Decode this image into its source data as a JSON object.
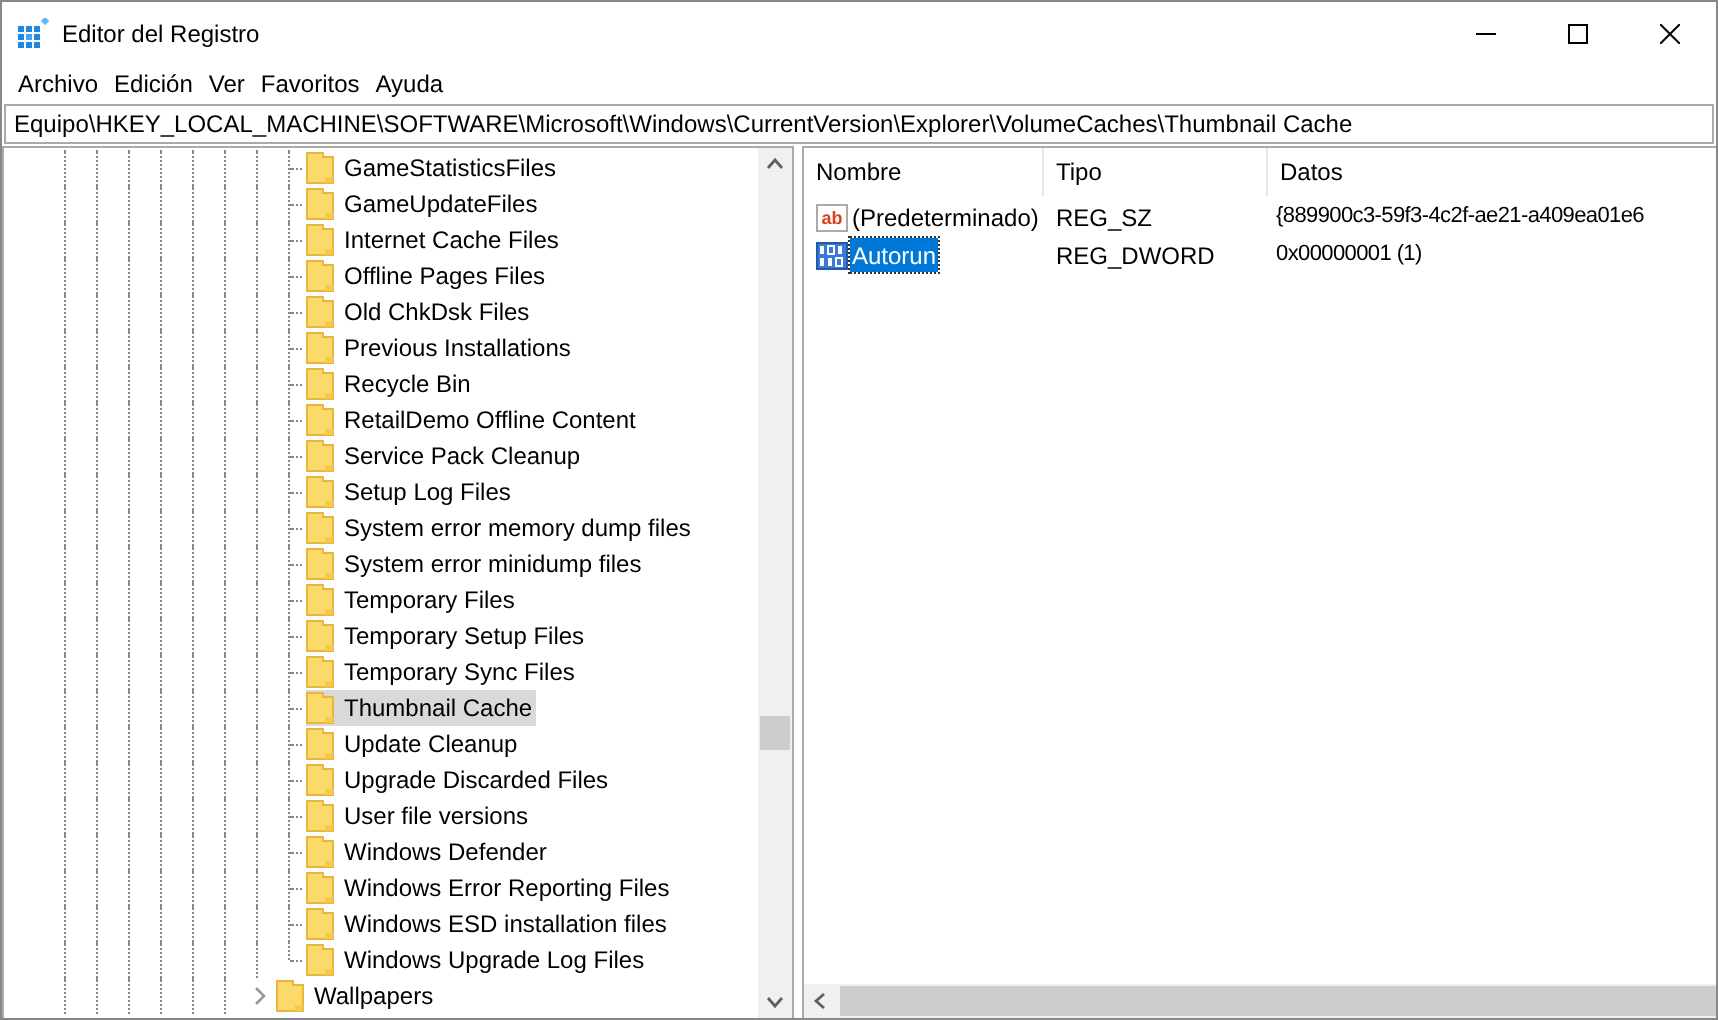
{
  "window": {
    "title": "Editor del Registro"
  },
  "menu": [
    "Archivo",
    "Edición",
    "Ver",
    "Favoritos",
    "Ayuda"
  ],
  "address": "Equipo\\HKEY_LOCAL_MACHINE\\SOFTWARE\\Microsoft\\Windows\\CurrentVersion\\Explorer\\VolumeCaches\\Thumbnail Cache",
  "tree": {
    "child_items": [
      {
        "label": "GameStatisticsFiles",
        "selected": false
      },
      {
        "label": "GameUpdateFiles",
        "selected": false
      },
      {
        "label": "Internet Cache Files",
        "selected": false
      },
      {
        "label": "Offline Pages Files",
        "selected": false
      },
      {
        "label": "Old ChkDsk Files",
        "selected": false
      },
      {
        "label": "Previous Installations",
        "selected": false
      },
      {
        "label": "Recycle Bin",
        "selected": false
      },
      {
        "label": "RetailDemo Offline Content",
        "selected": false
      },
      {
        "label": "Service Pack Cleanup",
        "selected": false
      },
      {
        "label": "Setup Log Files",
        "selected": false
      },
      {
        "label": "System error memory dump files",
        "selected": false
      },
      {
        "label": "System error minidump files",
        "selected": false
      },
      {
        "label": "Temporary Files",
        "selected": false
      },
      {
        "label": "Temporary Setup Files",
        "selected": false
      },
      {
        "label": "Temporary Sync Files",
        "selected": false
      },
      {
        "label": "Thumbnail Cache",
        "selected": true
      },
      {
        "label": "Update Cleanup",
        "selected": false
      },
      {
        "label": "Upgrade Discarded Files",
        "selected": false
      },
      {
        "label": "User file versions",
        "selected": false
      },
      {
        "label": "Windows Defender",
        "selected": false
      },
      {
        "label": "Windows Error Reporting Files",
        "selected": false
      },
      {
        "label": "Windows ESD installation files",
        "selected": false
      },
      {
        "label": "Windows Upgrade Log Files",
        "selected": false
      }
    ],
    "sibling_items": [
      {
        "label": "Wallpapers",
        "selected": false,
        "expanded": false
      }
    ]
  },
  "values": {
    "columns": [
      "Nombre",
      "Tipo",
      "Datos"
    ],
    "rows": [
      {
        "kind": "string",
        "icon_text": "ab",
        "name": "(Predeterminado)",
        "type": "REG_SZ",
        "data": "{889900c3-59f3-4c2f-ae21-a409ea01e6",
        "selected": false
      },
      {
        "kind": "binary",
        "name": "Autorun",
        "type": "REG_DWORD",
        "data": "0x00000001 (1)",
        "selected": true
      }
    ]
  }
}
